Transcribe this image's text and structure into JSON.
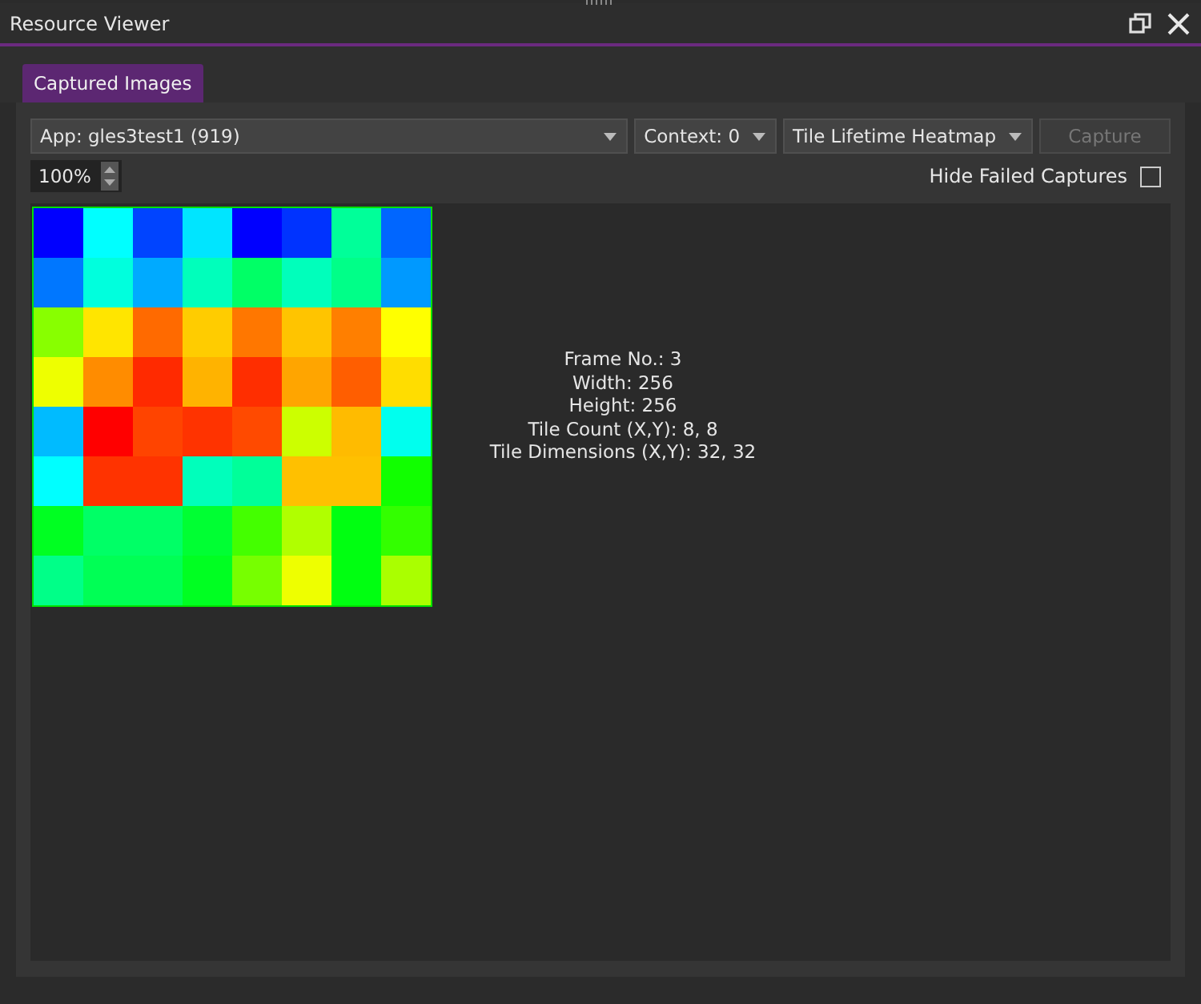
{
  "window": {
    "title": "Resource Viewer"
  },
  "tabs": [
    {
      "label": "Captured Images",
      "selected": true
    }
  ],
  "toolbar": {
    "app_dropdown": "App: gles3test1 (919)",
    "context_dropdown": "Context: 0",
    "mode_dropdown": "Tile Lifetime Heatmap",
    "capture_button": {
      "label": "Capture",
      "disabled": true
    },
    "zoom": "100%",
    "hide_failed": {
      "label": "Hide Failed Captures",
      "checked": false
    }
  },
  "heatmap": {
    "rows": [
      {
        "tiles": [
          {
            "color": "#0000ff"
          },
          {
            "color": "#00ffff"
          },
          {
            "color": "#0044ff"
          },
          {
            "color": "#00e5ff"
          },
          {
            "color": "#0000ff"
          },
          {
            "color": "#0033ff"
          },
          {
            "color": "#00ff99"
          },
          {
            "color": "#0066ff"
          }
        ]
      },
      {
        "tiles": [
          {
            "color": "#0077ff"
          },
          {
            "color": "#00ffdd"
          },
          {
            "color": "#00aaff"
          },
          {
            "color": "#00ffbb"
          },
          {
            "color": "#00ff66"
          },
          {
            "color": "#00ffbb"
          },
          {
            "color": "#00ff88"
          },
          {
            "color": "#0099ff"
          }
        ]
      },
      {
        "tiles": [
          {
            "color": "#88ff00"
          },
          {
            "color": "#ffe500"
          },
          {
            "color": "#ff6a00"
          },
          {
            "color": "#ffcc00"
          },
          {
            "color": "#ff7700"
          },
          {
            "color": "#ffc400"
          },
          {
            "color": "#ff7f00"
          },
          {
            "color": "#ffff00"
          }
        ]
      },
      {
        "tiles": [
          {
            "color": "#eeff00"
          },
          {
            "color": "#ff8c00"
          },
          {
            "color": "#ff2a00"
          },
          {
            "color": "#ffb300"
          },
          {
            "color": "#ff2e00"
          },
          {
            "color": "#ffa500"
          },
          {
            "color": "#ff5e00"
          },
          {
            "color": "#ffdd00"
          }
        ]
      },
      {
        "tiles": [
          {
            "color": "#00bbff"
          },
          {
            "color": "#ff0000"
          },
          {
            "color": "#ff4400"
          },
          {
            "color": "#ff3300"
          },
          {
            "color": "#ff4a00"
          },
          {
            "color": "#ccff00"
          },
          {
            "color": "#ffbb00"
          },
          {
            "color": "#00ffee"
          }
        ]
      },
      {
        "tiles": [
          {
            "color": "#00ffff"
          },
          {
            "color": "#ff3300"
          },
          {
            "color": "#ff3300"
          },
          {
            "color": "#00ffbb"
          },
          {
            "color": "#00ff99"
          },
          {
            "color": "#ffc000"
          },
          {
            "color": "#ffc000"
          },
          {
            "color": "#11ff00"
          }
        ]
      },
      {
        "tiles": [
          {
            "color": "#00ff22"
          },
          {
            "color": "#00ff66"
          },
          {
            "color": "#00ff66"
          },
          {
            "color": "#00ff33"
          },
          {
            "color": "#44ff00"
          },
          {
            "color": "#b0ff00"
          },
          {
            "color": "#00ff11"
          },
          {
            "color": "#33ff00"
          }
        ]
      },
      {
        "tiles": [
          {
            "color": "#00ff88"
          },
          {
            "color": "#00ff55"
          },
          {
            "color": "#00ff55"
          },
          {
            "color": "#00ff22"
          },
          {
            "color": "#77ff00"
          },
          {
            "color": "#eeff00"
          },
          {
            "color": "#00ff11"
          },
          {
            "color": "#aaff00"
          }
        ]
      }
    ]
  },
  "info": [
    "Frame No.: 3",
    "Width: 256",
    "Height: 256",
    "Tile Count (X,Y): 8, 8",
    "Tile Dimensions (X,Y): 32, 32"
  ]
}
